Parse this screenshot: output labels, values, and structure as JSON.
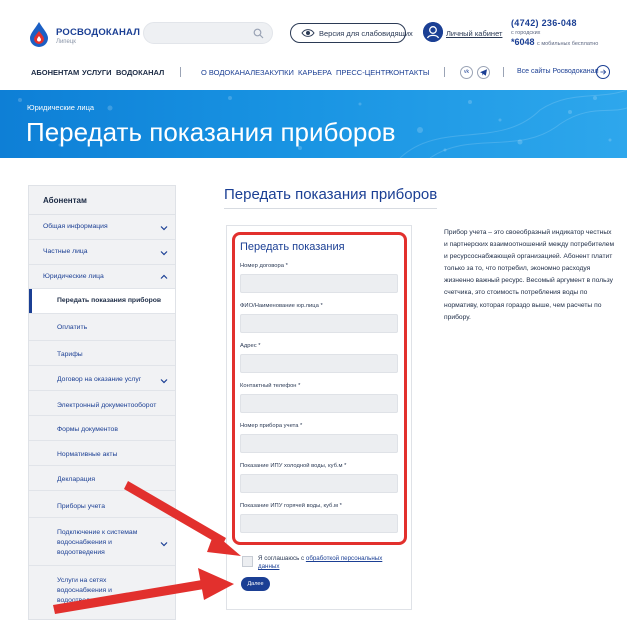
{
  "header": {
    "logo_name": "РОСВОДОКАНАЛ",
    "logo_city": "Липецк",
    "search_placeholder": "",
    "vision_button": "Версия для слабовидящих",
    "cabinet_link": "Личный кабинет",
    "phone_main": "(4742) 236-048",
    "phone_main_note": "с городских",
    "phone_short": "*6048",
    "phone_short_note": "с мобильных бесплатно"
  },
  "nav": {
    "main": [
      "АБОНЕНТАМ",
      "УСЛУГИ",
      "ВОДОКАНАЛ"
    ],
    "secondary": [
      "О ВОДОКАНАЛЕ",
      "ЗАКУПКИ",
      "КАРЬЕРА",
      "ПРЕСС-ЦЕНТР",
      "КОНТАКТЫ"
    ],
    "social": [
      "vk",
      "tg"
    ],
    "all_sites": "Все сайты Росводоканал"
  },
  "banner": {
    "crumb": "Юридические лица",
    "title": "Передать показания приборов"
  },
  "sidebar": {
    "title": "Абонентам",
    "items": [
      {
        "label": "Общая информация",
        "chevron": "down"
      },
      {
        "label": "Частные лица",
        "chevron": "down"
      },
      {
        "label": "Юридические лица",
        "chevron": "up"
      },
      {
        "label": "Передать показания приборов",
        "active": true
      },
      {
        "label": "Оплатить"
      },
      {
        "label": "Тарифы"
      },
      {
        "label": "Договор на оказание услуг",
        "chevron": "down"
      },
      {
        "label": "Электронный документооборот"
      },
      {
        "label": "Формы документов"
      },
      {
        "label": "Нормативные акты"
      },
      {
        "label": "Декларация"
      },
      {
        "label": "Приборы учета"
      },
      {
        "label": "Подключение к системам водоснабжения и водоотведения",
        "chevron": "down"
      },
      {
        "label": "Услуги на сетях водоснабжения и водоотведения"
      }
    ]
  },
  "main": {
    "title": "Передать показания приборов",
    "form": {
      "heading": "Передать показания",
      "fields": [
        {
          "label": "Номер договора *",
          "value": ""
        },
        {
          "label": "ФИО/Наименование юр.лица *",
          "value": ""
        },
        {
          "label": "Адрес *",
          "value": ""
        },
        {
          "label": "Контактный телефон *",
          "value": ""
        },
        {
          "label": "Номер прибора учета *",
          "value": ""
        },
        {
          "label": "Показание ИПУ холодной воды, куб.м *",
          "value": ""
        },
        {
          "label": "Показание ИПУ горячей воды, куб.м *",
          "value": ""
        }
      ],
      "consent_text": "Я соглашаюсь с",
      "consent_link": "обработкой персональных данных",
      "submit": "Далее"
    },
    "description": "Прибор учета – это своеобразный индикатор честных и партнерских взаимоотношений между потребителем и ресурсоснабжающей организацией. Абонент платит только за то, что потребил, экономно расходуя жизненно важный ресурс. Весомый аргумент в пользу счетчика, это стоимость потребления воды по нормативу, которая гораздо выше, чем расчеты по прибору."
  },
  "colors": {
    "brand_blue": "#1b3f94",
    "banner_blue": "#1893e2",
    "highlight_red": "#e2302d"
  }
}
